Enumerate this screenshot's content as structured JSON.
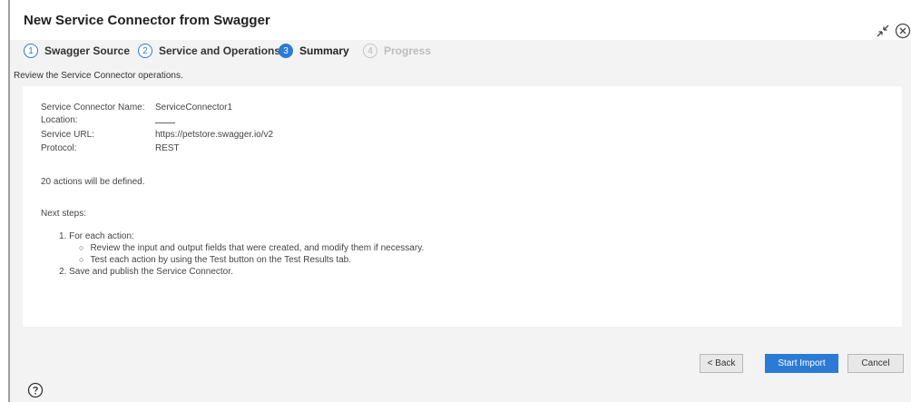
{
  "dialog": {
    "title": "New Service Connector from Swagger"
  },
  "steps": [
    {
      "num": "1",
      "label": "Swagger Source",
      "state": "done"
    },
    {
      "num": "2",
      "label": "Service and Operations",
      "state": "done"
    },
    {
      "num": "3",
      "label": "Summary",
      "state": "active"
    },
    {
      "num": "4",
      "label": "Progress",
      "state": "disabled"
    }
  ],
  "review_instruction": "Review the Service Connector operations.",
  "summary": {
    "fields": [
      {
        "label": "Service Connector Name:",
        "value": "ServiceConnector1"
      },
      {
        "label": "Location:",
        "value": ""
      },
      {
        "label": "Service URL:",
        "value": "https://petstore.swagger.io/v2"
      },
      {
        "label": "Protocol:",
        "value": "REST"
      }
    ],
    "actions_count_text": "20 actions will be defined.",
    "next_steps_heading": "Next steps:",
    "next_steps": {
      "step1": "1. For each action:",
      "step1_sub": [
        "Review the input and output fields that were created, and modify them if necessary.",
        "Test each action by using the Test button on the Test Results tab."
      ],
      "step2": "2. Save and publish the Service Connector."
    }
  },
  "buttons": {
    "back": "< Back",
    "start_import": "Start Import",
    "cancel": "Cancel"
  },
  "colors": {
    "accent": "#2b7bd6",
    "active_step_bg": "#dfe9f7",
    "dialog_bg": "#f3f3f3"
  },
  "icons": {
    "collapse": "collapse-arrows-icon",
    "close": "close-circle-icon",
    "help": "help-circle-icon"
  }
}
